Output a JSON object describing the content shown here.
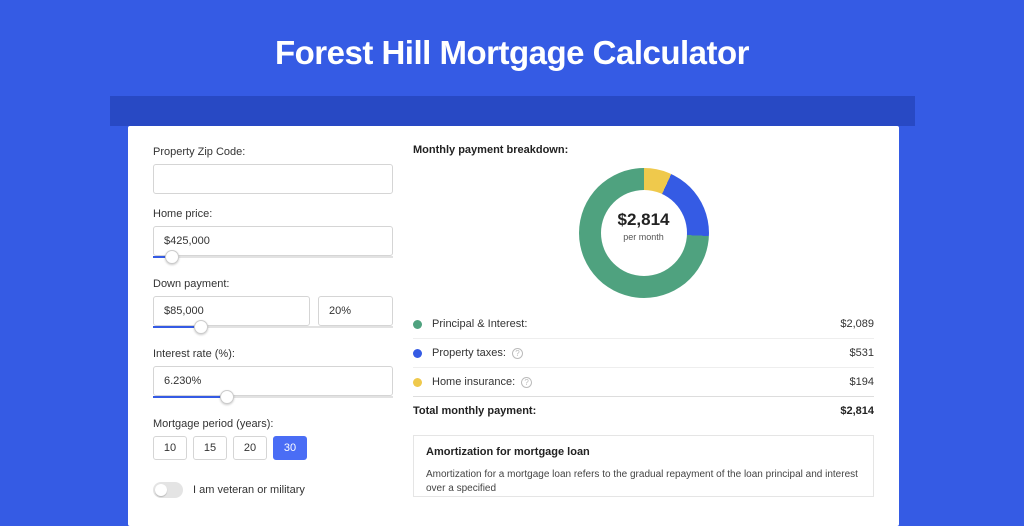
{
  "title": "Forest Hill Mortgage Calculator",
  "form": {
    "zip_label": "Property Zip Code:",
    "zip_value": "",
    "home_price_label": "Home price:",
    "home_price_value": "$425,000",
    "home_price_slider_pct": 8,
    "down_payment_label": "Down payment:",
    "down_payment_value": "$85,000",
    "down_payment_pct_value": "20%",
    "down_payment_slider_pct": 20,
    "interest_label": "Interest rate (%):",
    "interest_value": "6.230%",
    "interest_slider_pct": 31,
    "period_label": "Mortgage period (years):",
    "periods": [
      "10",
      "15",
      "20",
      "30"
    ],
    "period_selected_index": 3,
    "veteran_label": "I am veteran or military",
    "veteran_on": false
  },
  "breakdown": {
    "title": "Monthly payment breakdown:",
    "center_amount": "$2,814",
    "center_sub": "per month",
    "items": [
      {
        "color": "green",
        "label": "Principal & Interest:",
        "value": "$2,089",
        "info": false
      },
      {
        "color": "blue",
        "label": "Property taxes:",
        "value": "$531",
        "info": true
      },
      {
        "color": "yell",
        "label": "Home insurance:",
        "value": "$194",
        "info": true
      }
    ],
    "total_label": "Total monthly payment:",
    "total_value": "$2,814"
  },
  "amort": {
    "title": "Amortization for mortgage loan",
    "text": "Amortization for a mortgage loan refers to the gradual repayment of the loan principal and interest over a specified"
  },
  "chart_data": {
    "type": "pie",
    "title": "Monthly payment breakdown",
    "series": [
      {
        "name": "Principal & Interest",
        "value": 2089,
        "color": "#4FA27F"
      },
      {
        "name": "Property taxes",
        "value": 531,
        "color": "#355BE4"
      },
      {
        "name": "Home insurance",
        "value": 194,
        "color": "#EFC94C"
      }
    ],
    "total": 2814,
    "unit": "USD per month"
  }
}
